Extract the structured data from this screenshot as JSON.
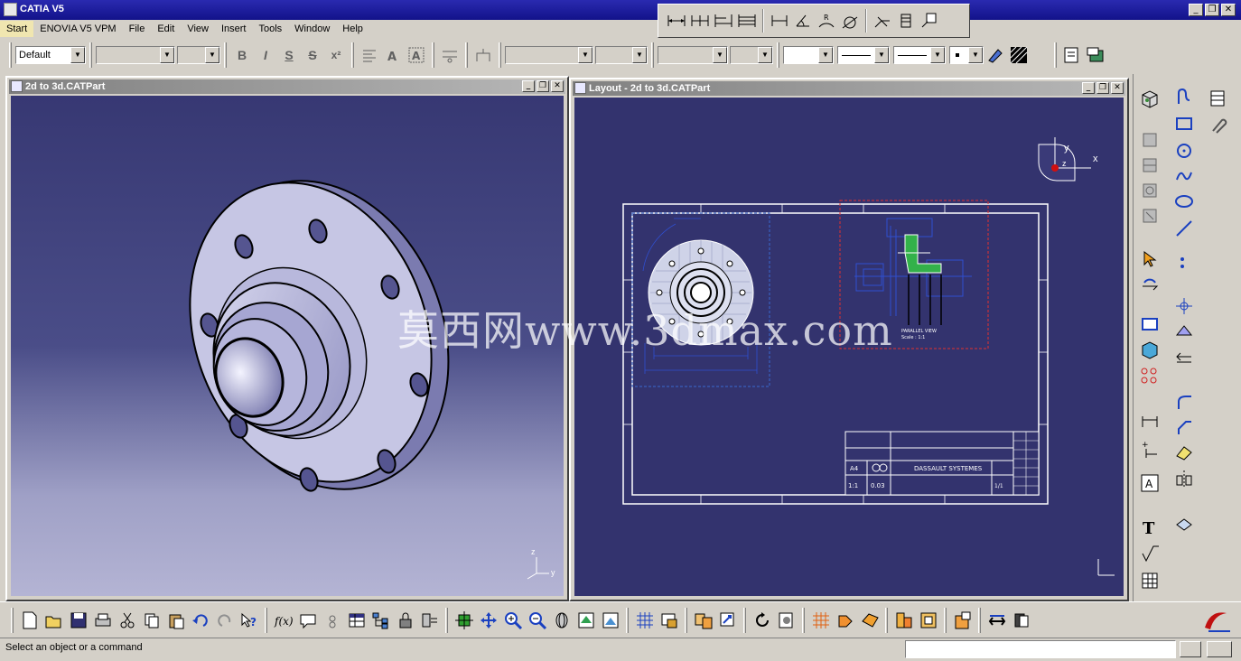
{
  "app": {
    "title": "CATIA V5",
    "window_buttons": {
      "minimize": "_",
      "restore": "❐",
      "close": "✕"
    }
  },
  "menu": [
    {
      "label": "Start",
      "active": true
    },
    {
      "label": "ENOVIA V5 VPM"
    },
    {
      "label": "File"
    },
    {
      "label": "Edit"
    },
    {
      "label": "View"
    },
    {
      "label": "Insert"
    },
    {
      "label": "Tools"
    },
    {
      "label": "Window"
    },
    {
      "label": "Help"
    }
  ],
  "format_toolbar": {
    "style_combo": "Default",
    "bold": "B",
    "italic": "I",
    "underline": "S",
    "strike": "S",
    "superscript": "x²"
  },
  "windows": {
    "part": {
      "title": "2d to 3d.CATPart"
    },
    "layout": {
      "title": "Layout - 2d to 3d.CATPart"
    }
  },
  "compass_axes": {
    "x": "x",
    "y": "y",
    "z": "z"
  },
  "drawing": {
    "company": "DASSAULT SYSTEMES",
    "sheet_format": "A4",
    "scale": "1:1",
    "weight": "0.03",
    "sheet_count": "1/1",
    "view_caption_1": "PARALLEL VIEW",
    "view_caption_2": "Scale : 1:1"
  },
  "watermark": "莫西网www.3dmax.com",
  "status": {
    "message": "Select an object or a command"
  },
  "colors": {
    "titlebar": "#12128a",
    "viewport_layout": "#33336e",
    "viewport_part_top": "#373873",
    "viewport_part_bottom": "#b4b4d4",
    "selection_red": "#e03030",
    "view_blue": "#3a6ad0"
  }
}
